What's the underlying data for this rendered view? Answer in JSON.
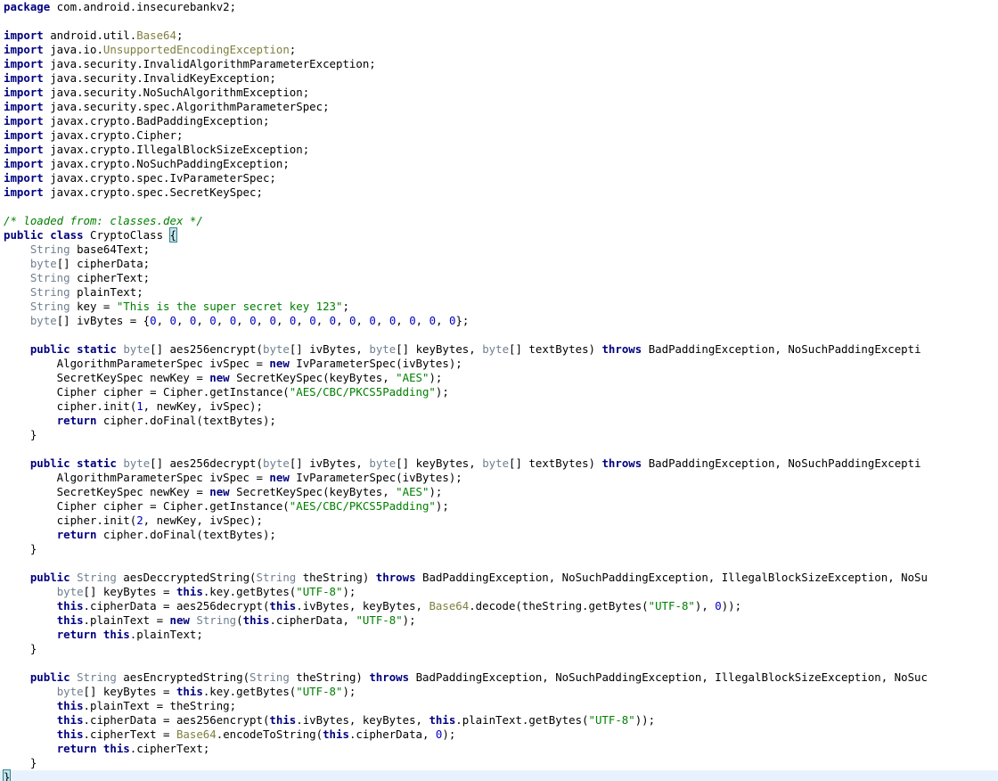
{
  "editor": {
    "current_line": 54,
    "lines": [
      [
        [
          "kw",
          "package"
        ],
        [
          "p",
          " com.android.insecurebankv2;"
        ]
      ],
      [],
      [
        [
          "kw",
          "import"
        ],
        [
          "p",
          " android.util."
        ],
        [
          "dc",
          "Base64"
        ],
        [
          "p",
          ";"
        ]
      ],
      [
        [
          "kw",
          "import"
        ],
        [
          "p",
          " java.io."
        ],
        [
          "dc",
          "UnsupportedEncodingException"
        ],
        [
          "p",
          ";"
        ]
      ],
      [
        [
          "kw",
          "import"
        ],
        [
          "p",
          " java.security.InvalidAlgorithmParameterException;"
        ]
      ],
      [
        [
          "kw",
          "import"
        ],
        [
          "p",
          " java.security.InvalidKeyException;"
        ]
      ],
      [
        [
          "kw",
          "import"
        ],
        [
          "p",
          " java.security.NoSuchAlgorithmException;"
        ]
      ],
      [
        [
          "kw",
          "import"
        ],
        [
          "p",
          " java.security.spec.AlgorithmParameterSpec;"
        ]
      ],
      [
        [
          "kw",
          "import"
        ],
        [
          "p",
          " javax.crypto.BadPaddingException;"
        ]
      ],
      [
        [
          "kw",
          "import"
        ],
        [
          "p",
          " javax.crypto.Cipher;"
        ]
      ],
      [
        [
          "kw",
          "import"
        ],
        [
          "p",
          " javax.crypto.IllegalBlockSizeException;"
        ]
      ],
      [
        [
          "kw",
          "import"
        ],
        [
          "p",
          " javax.crypto.NoSuchPaddingException;"
        ]
      ],
      [
        [
          "kw",
          "import"
        ],
        [
          "p",
          " javax.crypto.spec.IvParameterSpec;"
        ]
      ],
      [
        [
          "kw",
          "import"
        ],
        [
          "p",
          " javax.crypto.spec.SecretKeySpec;"
        ]
      ],
      [],
      [
        [
          "cm",
          "/* loaded from: classes.dex */"
        ]
      ],
      [
        [
          "kw",
          "public"
        ],
        [
          "p",
          " "
        ],
        [
          "kw",
          "class"
        ],
        [
          "p",
          " CryptoClass "
        ],
        [
          "br",
          "{"
        ]
      ],
      [
        [
          "p",
          "    "
        ],
        [
          "ty",
          "String"
        ],
        [
          "p",
          " base64Text;"
        ]
      ],
      [
        [
          "p",
          "    "
        ],
        [
          "ty",
          "byte"
        ],
        [
          "p",
          "[] cipherData;"
        ]
      ],
      [
        [
          "p",
          "    "
        ],
        [
          "ty",
          "String"
        ],
        [
          "p",
          " cipherText;"
        ]
      ],
      [
        [
          "p",
          "    "
        ],
        [
          "ty",
          "String"
        ],
        [
          "p",
          " plainText;"
        ]
      ],
      [
        [
          "p",
          "    "
        ],
        [
          "ty",
          "String"
        ],
        [
          "p",
          " key = "
        ],
        [
          "st",
          "\"This is the super secret key 123\""
        ],
        [
          "p",
          ";"
        ]
      ],
      [
        [
          "p",
          "    "
        ],
        [
          "ty",
          "byte"
        ],
        [
          "p",
          "[] ivBytes = {"
        ],
        [
          "nm",
          "0"
        ],
        [
          "p",
          ", "
        ],
        [
          "nm",
          "0"
        ],
        [
          "p",
          ", "
        ],
        [
          "nm",
          "0"
        ],
        [
          "p",
          ", "
        ],
        [
          "nm",
          "0"
        ],
        [
          "p",
          ", "
        ],
        [
          "nm",
          "0"
        ],
        [
          "p",
          ", "
        ],
        [
          "nm",
          "0"
        ],
        [
          "p",
          ", "
        ],
        [
          "nm",
          "0"
        ],
        [
          "p",
          ", "
        ],
        [
          "nm",
          "0"
        ],
        [
          "p",
          ", "
        ],
        [
          "nm",
          "0"
        ],
        [
          "p",
          ", "
        ],
        [
          "nm",
          "0"
        ],
        [
          "p",
          ", "
        ],
        [
          "nm",
          "0"
        ],
        [
          "p",
          ", "
        ],
        [
          "nm",
          "0"
        ],
        [
          "p",
          ", "
        ],
        [
          "nm",
          "0"
        ],
        [
          "p",
          ", "
        ],
        [
          "nm",
          "0"
        ],
        [
          "p",
          ", "
        ],
        [
          "nm",
          "0"
        ],
        [
          "p",
          ", "
        ],
        [
          "nm",
          "0"
        ],
        [
          "p",
          "};"
        ]
      ],
      [],
      [
        [
          "p",
          "    "
        ],
        [
          "kw",
          "public"
        ],
        [
          "p",
          " "
        ],
        [
          "kw",
          "static"
        ],
        [
          "p",
          " "
        ],
        [
          "ty",
          "byte"
        ],
        [
          "p",
          "[] aes256encrypt("
        ],
        [
          "ty",
          "byte"
        ],
        [
          "p",
          "[] ivBytes, "
        ],
        [
          "ty",
          "byte"
        ],
        [
          "p",
          "[] keyBytes, "
        ],
        [
          "ty",
          "byte"
        ],
        [
          "p",
          "[] textBytes) "
        ],
        [
          "kw",
          "throws"
        ],
        [
          "p",
          " BadPaddingException, NoSuchPaddingExcepti"
        ]
      ],
      [
        [
          "p",
          "        AlgorithmParameterSpec ivSpec = "
        ],
        [
          "kw",
          "new"
        ],
        [
          "p",
          " IvParameterSpec(ivBytes);"
        ]
      ],
      [
        [
          "p",
          "        SecretKeySpec newKey = "
        ],
        [
          "kw",
          "new"
        ],
        [
          "p",
          " SecretKeySpec(keyBytes, "
        ],
        [
          "st",
          "\"AES\""
        ],
        [
          "p",
          ");"
        ]
      ],
      [
        [
          "p",
          "        Cipher cipher = Cipher.getInstance("
        ],
        [
          "st",
          "\"AES/CBC/PKCS5Padding\""
        ],
        [
          "p",
          ");"
        ]
      ],
      [
        [
          "p",
          "        cipher.init("
        ],
        [
          "nm",
          "1"
        ],
        [
          "p",
          ", newKey, ivSpec);"
        ]
      ],
      [
        [
          "p",
          "        "
        ],
        [
          "kw",
          "return"
        ],
        [
          "p",
          " cipher.doFinal(textBytes);"
        ]
      ],
      [
        [
          "p",
          "    }"
        ]
      ],
      [],
      [
        [
          "p",
          "    "
        ],
        [
          "kw",
          "public"
        ],
        [
          "p",
          " "
        ],
        [
          "kw",
          "static"
        ],
        [
          "p",
          " "
        ],
        [
          "ty",
          "byte"
        ],
        [
          "p",
          "[] aes256decrypt("
        ],
        [
          "ty",
          "byte"
        ],
        [
          "p",
          "[] ivBytes, "
        ],
        [
          "ty",
          "byte"
        ],
        [
          "p",
          "[] keyBytes, "
        ],
        [
          "ty",
          "byte"
        ],
        [
          "p",
          "[] textBytes) "
        ],
        [
          "kw",
          "throws"
        ],
        [
          "p",
          " BadPaddingException, NoSuchPaddingExcepti"
        ]
      ],
      [
        [
          "p",
          "        AlgorithmParameterSpec ivSpec = "
        ],
        [
          "kw",
          "new"
        ],
        [
          "p",
          " IvParameterSpec(ivBytes);"
        ]
      ],
      [
        [
          "p",
          "        SecretKeySpec newKey = "
        ],
        [
          "kw",
          "new"
        ],
        [
          "p",
          " SecretKeySpec(keyBytes, "
        ],
        [
          "st",
          "\"AES\""
        ],
        [
          "p",
          ");"
        ]
      ],
      [
        [
          "p",
          "        Cipher cipher = Cipher.getInstance("
        ],
        [
          "st",
          "\"AES/CBC/PKCS5Padding\""
        ],
        [
          "p",
          ");"
        ]
      ],
      [
        [
          "p",
          "        cipher.init("
        ],
        [
          "nm",
          "2"
        ],
        [
          "p",
          ", newKey, ivSpec);"
        ]
      ],
      [
        [
          "p",
          "        "
        ],
        [
          "kw",
          "return"
        ],
        [
          "p",
          " cipher.doFinal(textBytes);"
        ]
      ],
      [
        [
          "p",
          "    }"
        ]
      ],
      [],
      [
        [
          "p",
          "    "
        ],
        [
          "kw",
          "public"
        ],
        [
          "p",
          " "
        ],
        [
          "ty",
          "String"
        ],
        [
          "p",
          " aesDeccryptedString("
        ],
        [
          "ty",
          "String"
        ],
        [
          "p",
          " theString) "
        ],
        [
          "kw",
          "throws"
        ],
        [
          "p",
          " BadPaddingException, NoSuchPaddingException, IllegalBlockSizeException, NoSu"
        ]
      ],
      [
        [
          "p",
          "        "
        ],
        [
          "ty",
          "byte"
        ],
        [
          "p",
          "[] keyBytes = "
        ],
        [
          "kw",
          "this"
        ],
        [
          "p",
          ".key.getBytes("
        ],
        [
          "st",
          "\"UTF-8\""
        ],
        [
          "p",
          ");"
        ]
      ],
      [
        [
          "p",
          "        "
        ],
        [
          "kw",
          "this"
        ],
        [
          "p",
          ".cipherData = aes256decrypt("
        ],
        [
          "kw",
          "this"
        ],
        [
          "p",
          ".ivBytes, keyBytes, "
        ],
        [
          "dc",
          "Base64"
        ],
        [
          "p",
          ".decode(theString.getBytes("
        ],
        [
          "st",
          "\"UTF-8\""
        ],
        [
          "p",
          "), "
        ],
        [
          "nm",
          "0"
        ],
        [
          "p",
          "));"
        ]
      ],
      [
        [
          "p",
          "        "
        ],
        [
          "kw",
          "this"
        ],
        [
          "p",
          ".plainText = "
        ],
        [
          "kw",
          "new"
        ],
        [
          "p",
          " "
        ],
        [
          "ty",
          "String"
        ],
        [
          "p",
          "("
        ],
        [
          "kw",
          "this"
        ],
        [
          "p",
          ".cipherData, "
        ],
        [
          "st",
          "\"UTF-8\""
        ],
        [
          "p",
          ");"
        ]
      ],
      [
        [
          "p",
          "        "
        ],
        [
          "kw",
          "return"
        ],
        [
          "p",
          " "
        ],
        [
          "kw",
          "this"
        ],
        [
          "p",
          ".plainText;"
        ]
      ],
      [
        [
          "p",
          "    }"
        ]
      ],
      [],
      [
        [
          "p",
          "    "
        ],
        [
          "kw",
          "public"
        ],
        [
          "p",
          " "
        ],
        [
          "ty",
          "String"
        ],
        [
          "p",
          " aesEncryptedString("
        ],
        [
          "ty",
          "String"
        ],
        [
          "p",
          " theString) "
        ],
        [
          "kw",
          "throws"
        ],
        [
          "p",
          " BadPaddingException, NoSuchPaddingException, IllegalBlockSizeException, NoSuc"
        ]
      ],
      [
        [
          "p",
          "        "
        ],
        [
          "ty",
          "byte"
        ],
        [
          "p",
          "[] keyBytes = "
        ],
        [
          "kw",
          "this"
        ],
        [
          "p",
          ".key.getBytes("
        ],
        [
          "st",
          "\"UTF-8\""
        ],
        [
          "p",
          ");"
        ]
      ],
      [
        [
          "p",
          "        "
        ],
        [
          "kw",
          "this"
        ],
        [
          "p",
          ".plainText = theString;"
        ]
      ],
      [
        [
          "p",
          "        "
        ],
        [
          "kw",
          "this"
        ],
        [
          "p",
          ".cipherData = aes256encrypt("
        ],
        [
          "kw",
          "this"
        ],
        [
          "p",
          ".ivBytes, keyBytes, "
        ],
        [
          "kw",
          "this"
        ],
        [
          "p",
          ".plainText.getBytes("
        ],
        [
          "st",
          "\"UTF-8\""
        ],
        [
          "p",
          "));"
        ]
      ],
      [
        [
          "p",
          "        "
        ],
        [
          "kw",
          "this"
        ],
        [
          "p",
          ".cipherText = "
        ],
        [
          "dc",
          "Base64"
        ],
        [
          "p",
          ".encodeToString("
        ],
        [
          "kw",
          "this"
        ],
        [
          "p",
          ".cipherData, "
        ],
        [
          "nm",
          "0"
        ],
        [
          "p",
          ");"
        ]
      ],
      [
        [
          "p",
          "        "
        ],
        [
          "kw",
          "return"
        ],
        [
          "p",
          " "
        ],
        [
          "kw",
          "this"
        ],
        [
          "p",
          ".cipherText;"
        ]
      ],
      [
        [
          "p",
          "    }"
        ]
      ],
      [
        [
          "br",
          "}"
        ]
      ]
    ]
  }
}
